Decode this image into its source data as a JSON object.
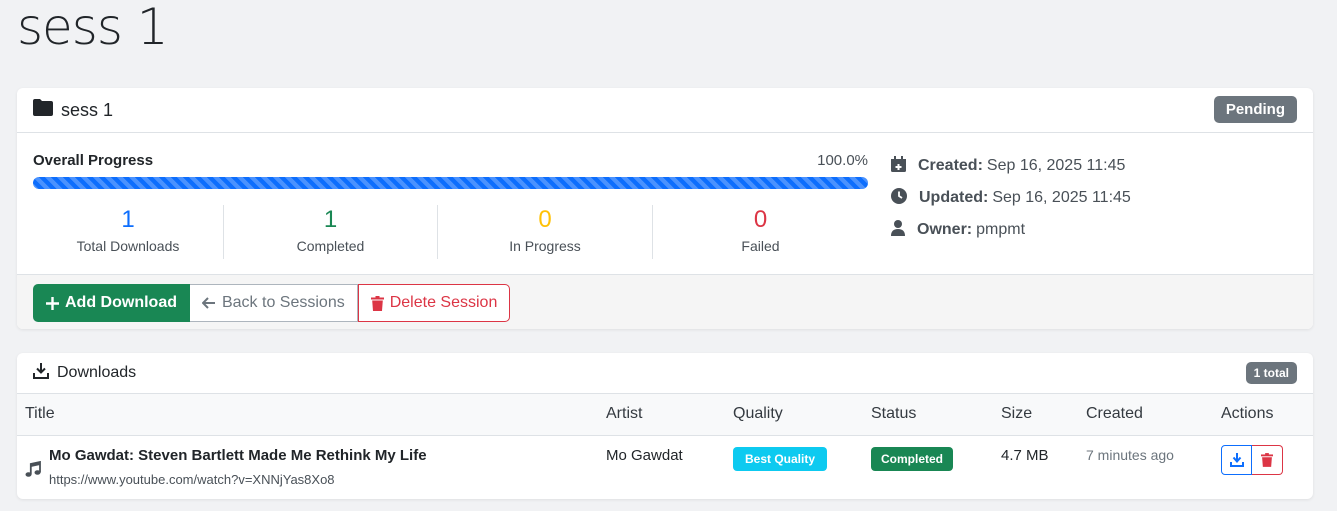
{
  "page": {
    "title": "sess 1"
  },
  "session": {
    "name": "sess 1",
    "status": "Pending",
    "progress_label": "Overall Progress",
    "progress_text": "100.0%",
    "progress_value": 100,
    "stats": [
      {
        "value": "1",
        "label": "Total Downloads",
        "color": "#0d6efd"
      },
      {
        "value": "1",
        "label": "Completed",
        "color": "#198754"
      },
      {
        "value": "0",
        "label": "In Progress",
        "color": "#ffc107"
      },
      {
        "value": "0",
        "label": "Failed",
        "color": "#dc3545"
      }
    ],
    "meta": {
      "created_label": "Created:",
      "created": "Sep 16, 2025 11:45",
      "updated_label": "Updated:",
      "updated": "Sep 16, 2025 11:45",
      "owner_label": "Owner:",
      "owner": "pmpmt"
    },
    "buttons": {
      "add": "Add Download",
      "back": "Back to Sessions",
      "delete": "Delete Session"
    }
  },
  "downloads": {
    "title": "Downloads",
    "total_badge": "1 total",
    "columns": [
      "Title",
      "Artist",
      "Quality",
      "Status",
      "Size",
      "Created",
      "Actions"
    ],
    "rows": [
      {
        "title": "Mo Gawdat: Steven Bartlett Made Me Rethink My Life",
        "url": "https://www.youtube.com/watch?v=XNNjYas8Xo8",
        "artist": "Mo Gawdat",
        "quality": "Best Quality",
        "status": "Completed",
        "size": "4.7 MB",
        "created": "7 minutes ago"
      }
    ]
  },
  "colors": {
    "primary": "#0d6efd",
    "success": "#198754",
    "warning": "#ffc107",
    "danger": "#dc3545",
    "info": "#0dcaf0",
    "secondary": "#6c757d"
  },
  "icons": [
    "folder-icon",
    "calendar-plus-icon",
    "clock-icon",
    "user-icon",
    "plus-icon",
    "arrow-left-icon",
    "trash-icon",
    "download-icon",
    "music-icon"
  ]
}
